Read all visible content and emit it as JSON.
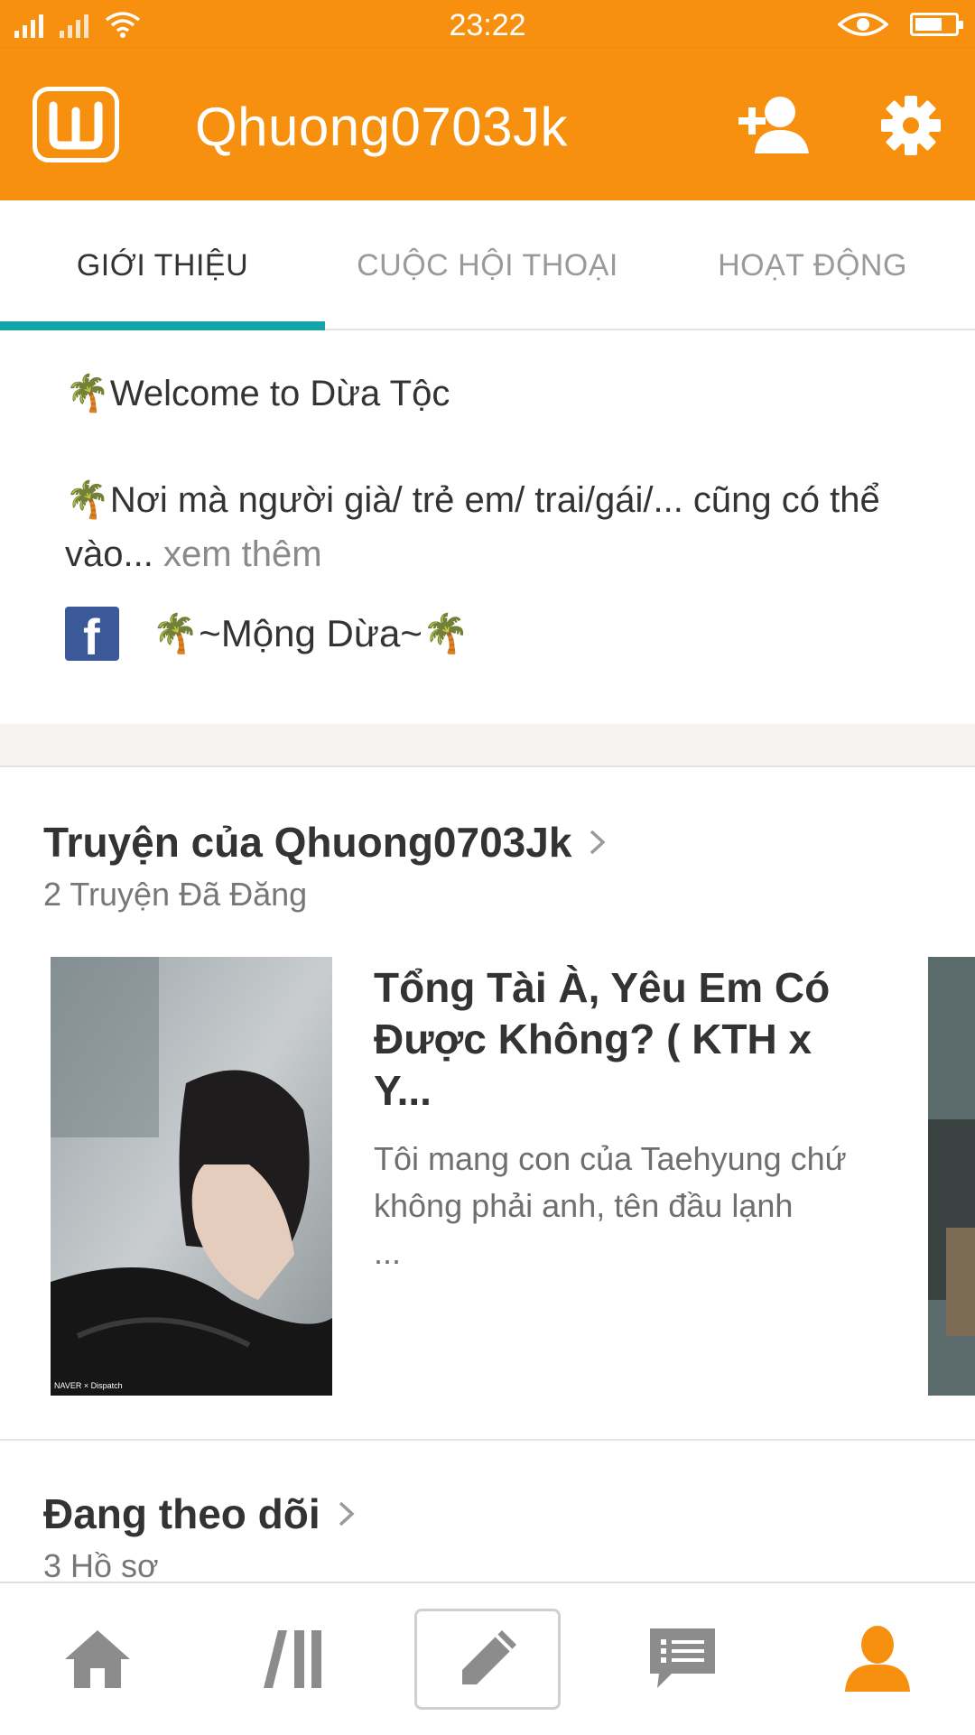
{
  "status_bar": {
    "time": "23:22"
  },
  "header": {
    "title": "Qhuong0703Jk"
  },
  "tabs": [
    {
      "label": "GIỚI THIỆU",
      "active": true
    },
    {
      "label": "CUỘC HỘI THOẠI",
      "active": false
    },
    {
      "label": "HOẠT ĐỘNG",
      "active": false
    }
  ],
  "about": {
    "line1": "Welcome to Dừa Tộc",
    "line2": "Nơi mà người già/ trẻ em/ trai/gái/... cũng có thể vào...",
    "more_link": " xem thêm",
    "facebook_name": "~Mộng Dừa~",
    "emoji": "🌴"
  },
  "stories_section": {
    "title": "Truyện của Qhuong0703Jk",
    "subtitle": "2 Truyện Đã Đăng",
    "items": [
      {
        "title": "Tổng Tài À, Yêu Em Có Được Không? ( KTH x Y...",
        "description": "Tôi mang con của Taehyung chứ không phải anh, tên đầu lạnh",
        "ellipsis": "...",
        "cover_caption": "NAVER × Dispatch"
      }
    ]
  },
  "following_section": {
    "title": "Đang theo dõi",
    "subtitle": "3 Hồ sơ"
  },
  "bottom_nav": [
    {
      "icon": "home-icon",
      "active": false
    },
    {
      "icon": "library-icon",
      "active": false
    },
    {
      "icon": "pencil-icon",
      "active": false
    },
    {
      "icon": "messages-icon",
      "active": false
    },
    {
      "icon": "profile-icon",
      "active": true
    }
  ],
  "colors": {
    "brand": "#f7900e",
    "tab_indicator": "#14a3a6",
    "nav_inactive": "#8c8c8c",
    "nav_active": "#f7900e"
  }
}
